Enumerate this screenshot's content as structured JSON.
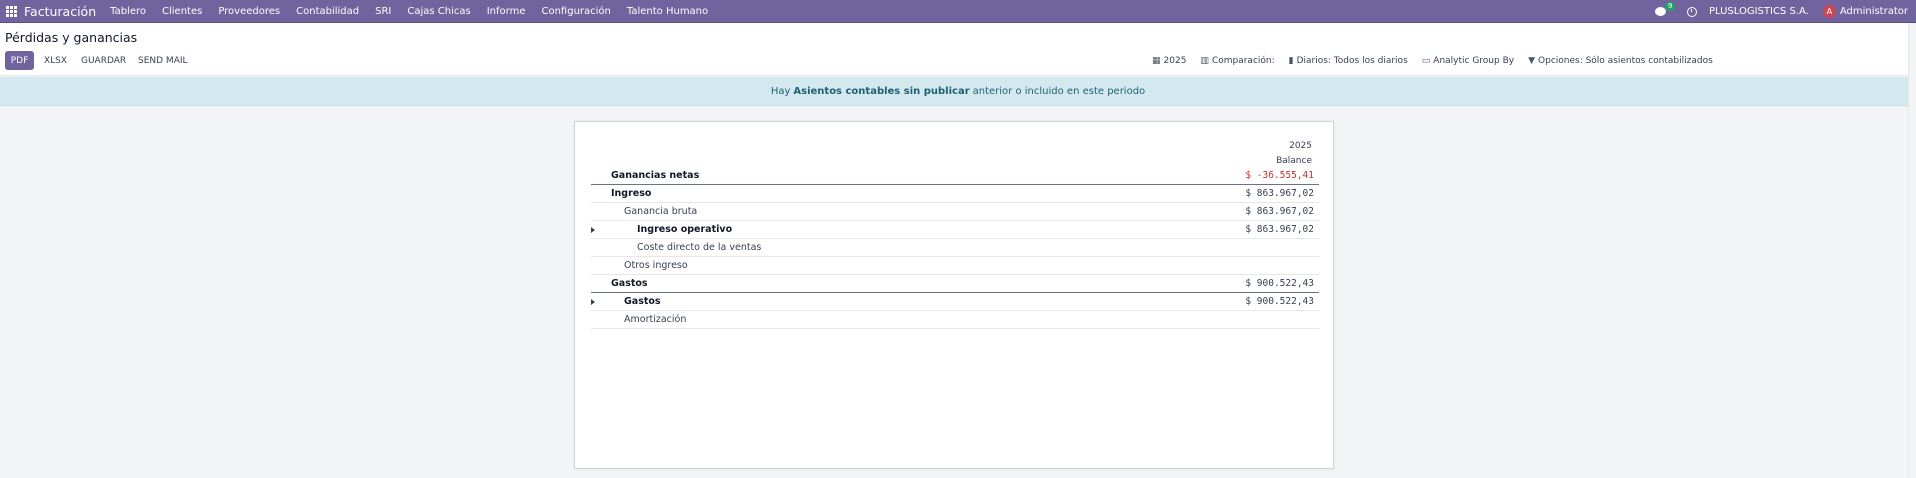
{
  "navbar": {
    "app_name": "Facturación",
    "menu": [
      "Tablero",
      "Clientes",
      "Proveedores",
      "Contabilidad",
      "SRI",
      "Cajas Chicas",
      "Informe",
      "Configuración",
      "Talento Humano"
    ],
    "chat_count": "9",
    "company": "PLUSLOGISTICS S.A.",
    "avatar_letter": "A",
    "user": "Administrator"
  },
  "control": {
    "title": "Pérdidas y ganancias",
    "buttons": {
      "pdf": "PDF",
      "xlsx": "XLSX",
      "save": "GUARDAR",
      "send_mail": "SEND MAIL"
    },
    "filters": {
      "year": "2025",
      "comparison": "Comparación:",
      "journals": "Diarios: Todos los diarios",
      "analytic": "Analytic Group By",
      "options": "Opciones: Sólo asientos contabilizados"
    }
  },
  "alert": {
    "prefix": "Hay",
    "link": "Asientos contables sin publicar",
    "suffix": "anterior o incluido en este periodo"
  },
  "report": {
    "col_year": "2025",
    "col_name": "Balance",
    "rows": [
      {
        "label": "Ganancias netas",
        "value": "$ -36.555,41"
      },
      {
        "label": "Ingreso",
        "value": "$ 863.967,02"
      },
      {
        "label": "Ganancia bruta",
        "value": "$ 863.967,02"
      },
      {
        "label": "Ingreso operativo",
        "value": "$ 863.967,02"
      },
      {
        "label": "Coste directo de la ventas",
        "value": ""
      },
      {
        "label": "Otros ingreso",
        "value": ""
      },
      {
        "label": "Gastos",
        "value": "$ 900.522,43"
      },
      {
        "label": "Gastos",
        "value": "$ 900.522,43"
      },
      {
        "label": "Amortización",
        "value": ""
      }
    ]
  }
}
